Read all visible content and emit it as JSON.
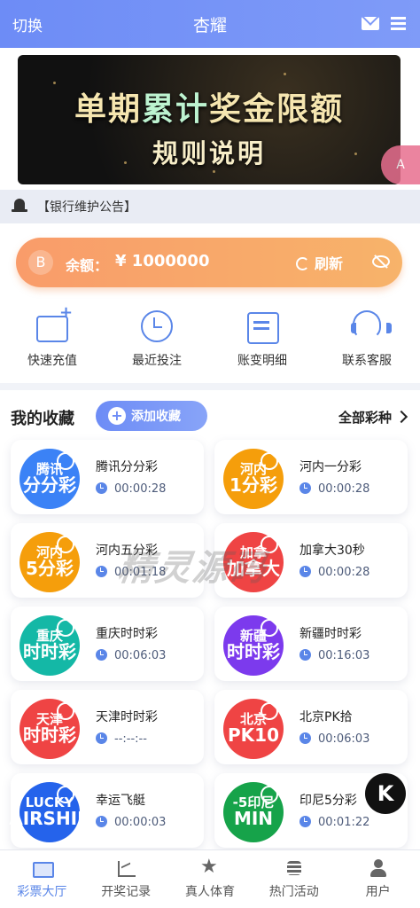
{
  "header": {
    "switch_label": "切换",
    "title": "杏耀",
    "mail_icon": "mail-icon",
    "menu_icon": "menu-icon"
  },
  "banner": {
    "line1_a": "单期",
    "line1_b": "累计",
    "line1_c": "奖金限额",
    "line2": "规则说明"
  },
  "translate_fab": {
    "label": "A",
    "icon": "translate-icon"
  },
  "notice": {
    "text": "【银行维护公告】",
    "icon": "bell-icon"
  },
  "balance": {
    "avatar": "B",
    "label": "余额：",
    "amount": "¥ 1000000",
    "refresh_label": "刷新"
  },
  "quick_actions": [
    {
      "label": "快速充值",
      "icon": "recharge-icon"
    },
    {
      "label": "最近投注",
      "icon": "clock-icon"
    },
    {
      "label": "账变明细",
      "icon": "bill-icon"
    },
    {
      "label": "联系客服",
      "icon": "headset-icon"
    }
  ],
  "favorites": {
    "title": "我的收藏",
    "add_label": "添加收藏",
    "all_label": "全部彩种",
    "items": [
      {
        "name": "腾讯分分彩",
        "timer": "00:00:28",
        "logo_top": "腾讯",
        "logo_bottom": "分分彩",
        "color": "#3b82f6"
      },
      {
        "name": "河内一分彩",
        "timer": "00:00:28",
        "logo_top": "河内",
        "logo_bottom": "1分彩",
        "color": "#f59e0b"
      },
      {
        "name": "河内五分彩",
        "timer": "00:01:18",
        "logo_top": "河内",
        "logo_bottom": "5分彩",
        "color": "#f59e0b"
      },
      {
        "name": "加拿大30秒",
        "timer": "00:00:28",
        "logo_top": "加拿",
        "logo_bottom": "加拿大",
        "color": "#ef4444"
      },
      {
        "name": "重庆时时彩",
        "timer": "00:06:03",
        "logo_top": "重庆",
        "logo_bottom": "时时彩",
        "color": "#14b8a6"
      },
      {
        "name": "新疆时时彩",
        "timer": "00:16:03",
        "logo_top": "新疆",
        "logo_bottom": "时时彩",
        "color": "#7c3aed"
      },
      {
        "name": "天津时时彩",
        "timer": "--:--:--",
        "logo_top": "天津",
        "logo_bottom": "时时彩",
        "color": "#ef4444"
      },
      {
        "name": "北京PK拾",
        "timer": "00:06:03",
        "logo_top": "北京",
        "logo_bottom": "PK10",
        "color": "#ef4444"
      },
      {
        "name": "幸运飞艇",
        "timer": "00:00:03",
        "logo_top": "LUCKY",
        "logo_bottom": "AIRSHIP",
        "color": "#2563eb"
      },
      {
        "name": "印尼5分彩",
        "timer": "00:01:22",
        "logo_top": "-5印尼",
        "logo_bottom": "MIN",
        "color": "#16a34a"
      }
    ]
  },
  "watermark": "精灵源码",
  "k_fab": "K",
  "tabs": [
    {
      "label": "彩票大厅",
      "icon": "lottery-hall-icon",
      "active": true
    },
    {
      "label": "开奖记录",
      "icon": "chart-icon",
      "active": false
    },
    {
      "label": "真人体育",
      "icon": "star-icon",
      "active": false
    },
    {
      "label": "热门活动",
      "icon": "coins-icon",
      "active": false
    },
    {
      "label": "用户",
      "icon": "user-icon",
      "active": false
    }
  ]
}
